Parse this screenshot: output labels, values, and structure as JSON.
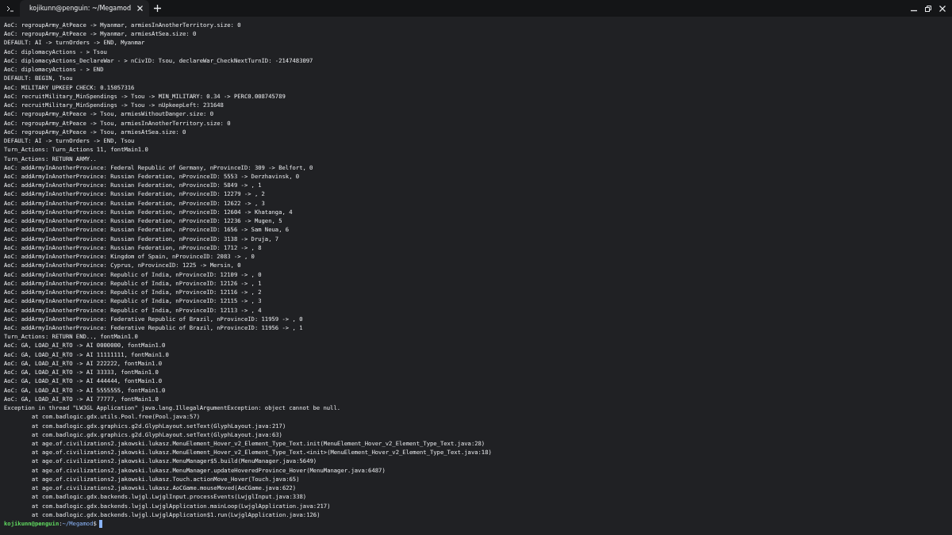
{
  "window": {
    "tabs": [
      {
        "title": "kojikunn@penguin: ~/Megamod",
        "selected": true
      }
    ]
  },
  "output": [
    {
      "kind": "log",
      "text": "AoC: regroupArmy_AtPeace -> Myanmar, armiesInAnotherTerritory.size: 0"
    },
    {
      "kind": "log",
      "text": "AoC: regroupArmy_AtPeace -> Myanmar, armiesAtSea.size: 0"
    },
    {
      "kind": "log",
      "text": "DEFAULT: AI -> turnOrders -> END, Myanmar"
    },
    {
      "kind": "log",
      "text": "AoC: diplomacyActions - > Tsou"
    },
    {
      "kind": "log",
      "text": "AoC: diplomacyActions_DeclareWar - > nCivID: Tsou, declareWar_CheckNextTurnID: -2147483097"
    },
    {
      "kind": "log",
      "text": "AoC: diplomacyActions - > END"
    },
    {
      "kind": "log",
      "text": "DEFAULT: BEGIN, Tsou"
    },
    {
      "kind": "log",
      "text": "AoC: MILITARY UPKEEP CHECK: 0.15057316"
    },
    {
      "kind": "log",
      "text": "AoC: recruitMilitary_MinSpendings -> Tsou -> MIN_MILITARY: 0.34 -> PERC0.008745789"
    },
    {
      "kind": "log",
      "text": "AoC: recruitMilitary_MinSpendings -> Tsou -> nUpkeepLeft: 231648"
    },
    {
      "kind": "log",
      "text": "AoC: regroupArmy_AtPeace -> Tsou, armiesWithoutDanger.size: 0"
    },
    {
      "kind": "log",
      "text": "AoC: regroupArmy_AtPeace -> Tsou, armiesInAnotherTerritory.size: 0"
    },
    {
      "kind": "log",
      "text": "AoC: regroupArmy_AtPeace -> Tsou, armiesAtSea.size: 0"
    },
    {
      "kind": "log",
      "text": "DEFAULT: AI -> turnOrders -> END, Tsou"
    },
    {
      "kind": "log",
      "text": "Turn_Actions: Turn_Actions 11, fontMain1.0"
    },
    {
      "kind": "log",
      "text": "Turn_Actions: RETURN ARMY.."
    },
    {
      "kind": "log",
      "text": "AoC: addArmyInAnotherProvince: Federal Republic of Germany, nProvinceID: 309 -> Belfort, 0"
    },
    {
      "kind": "log",
      "text": "AoC: addArmyInAnotherProvince: Russian Federation, nProvinceID: 5553 -> Derzhavinsk, 0"
    },
    {
      "kind": "log",
      "text": "AoC: addArmyInAnotherProvince: Russian Federation, nProvinceID: 5849 -> , 1"
    },
    {
      "kind": "log",
      "text": "AoC: addArmyInAnotherProvince: Russian Federation, nProvinceID: 12279 -> , 2"
    },
    {
      "kind": "log",
      "text": "AoC: addArmyInAnotherProvince: Russian Federation, nProvinceID: 12622 -> , 3"
    },
    {
      "kind": "log",
      "text": "AoC: addArmyInAnotherProvince: Russian Federation, nProvinceID: 12604 -> Khatanga, 4"
    },
    {
      "kind": "log",
      "text": "AoC: addArmyInAnotherProvince: Russian Federation, nProvinceID: 12236 -> Mugen, 5"
    },
    {
      "kind": "log",
      "text": "AoC: addArmyInAnotherProvince: Russian Federation, nProvinceID: 1656 -> Sam Neua, 6"
    },
    {
      "kind": "log",
      "text": "AoC: addArmyInAnotherProvince: Russian Federation, nProvinceID: 3138 -> Druja, 7"
    },
    {
      "kind": "log",
      "text": "AoC: addArmyInAnotherProvince: Russian Federation, nProvinceID: 1712 -> , 8"
    },
    {
      "kind": "log",
      "text": "AoC: addArmyInAnotherProvince: Kingdom of Spain, nProvinceID: 2083 -> , 0"
    },
    {
      "kind": "log",
      "text": "AoC: addArmyInAnotherProvince: Cyprus, nProvinceID: 1225 -> Mersin, 0"
    },
    {
      "kind": "log",
      "text": "AoC: addArmyInAnotherProvince: Republic of India, nProvinceID: 12109 -> , 0"
    },
    {
      "kind": "log",
      "text": "AoC: addArmyInAnotherProvince: Republic of India, nProvinceID: 12126 -> , 1"
    },
    {
      "kind": "log",
      "text": "AoC: addArmyInAnotherProvince: Republic of India, nProvinceID: 12116 -> , 2"
    },
    {
      "kind": "log",
      "text": "AoC: addArmyInAnotherProvince: Republic of India, nProvinceID: 12115 -> , 3"
    },
    {
      "kind": "log",
      "text": "AoC: addArmyInAnotherProvince: Republic of India, nProvinceID: 12113 -> , 4"
    },
    {
      "kind": "log",
      "text": "AoC: addArmyInAnotherProvince: Federative Republic of Brazil, nProvinceID: 11959 -> , 0"
    },
    {
      "kind": "log",
      "text": "AoC: addArmyInAnotherProvince: Federative Republic of Brazil, nProvinceID: 11956 -> , 1"
    },
    {
      "kind": "log",
      "text": "Turn_Actions: RETURN END.., fontMain1.0"
    },
    {
      "kind": "log",
      "text": "AoC: GA, LOAD_AI_RTO -> AI 0000000, fontMain1.0"
    },
    {
      "kind": "log",
      "text": "AoC: GA, LOAD_AI_RTO -> AI 11111111, fontMain1.0"
    },
    {
      "kind": "log",
      "text": "AoC: GA, LOAD_AI_RTO -> AI 222222, fontMain1.0"
    },
    {
      "kind": "log",
      "text": "AoC: GA, LOAD_AI_RTO -> AI 33333, fontMain1.0"
    },
    {
      "kind": "log",
      "text": "AoC: GA, LOAD_AI_RTO -> AI 444444, fontMain1.0"
    },
    {
      "kind": "log",
      "text": "AoC: GA, LOAD_AI_RTO -> AI 5555555, fontMain1.0"
    },
    {
      "kind": "log",
      "text": "AoC: GA, LOAD_AI_RTO -> AI 77777, fontMain1.0"
    },
    {
      "kind": "log",
      "text": "Exception in thread \"LWJGL Application\" java.lang.IllegalArgumentException: object cannot be null."
    },
    {
      "kind": "trace",
      "text": "at com.badlogic.gdx.utils.Pool.free(Pool.java:57)"
    },
    {
      "kind": "trace",
      "text": "at com.badlogic.gdx.graphics.g2d.GlyphLayout.setText(GlyphLayout.java:217)"
    },
    {
      "kind": "trace",
      "text": "at com.badlogic.gdx.graphics.g2d.GlyphLayout.setText(GlyphLayout.java:63)"
    },
    {
      "kind": "trace",
      "text": "at age.of.civilizations2.jakowski.lukasz.MenuElement_Hover_v2_Element_Type_Text.init(MenuElement_Hover_v2_Element_Type_Text.java:28)"
    },
    {
      "kind": "trace",
      "text": "at age.of.civilizations2.jakowski.lukasz.MenuElement_Hover_v2_Element_Type_Text.<init>(MenuElement_Hover_v2_Element_Type_Text.java:18)"
    },
    {
      "kind": "trace",
      "text": "at age.of.civilizations2.jakowski.lukasz.MenuManager$5.build(MenuManager.java:5649)"
    },
    {
      "kind": "trace",
      "text": "at age.of.civilizations2.jakowski.lukasz.MenuManager.updateHoveredProvince_Hover(MenuManager.java:6487)"
    },
    {
      "kind": "trace",
      "text": "at age.of.civilizations2.jakowski.lukasz.Touch.actionMove_Hover(Touch.java:65)"
    },
    {
      "kind": "trace",
      "text": "at age.of.civilizations2.jakowski.lukasz.AoCGame.mouseMoved(AoCGame.java:622)"
    },
    {
      "kind": "trace",
      "text": "at com.badlogic.gdx.backends.lwjgl.LwjglInput.processEvents(LwjglInput.java:338)"
    },
    {
      "kind": "trace",
      "text": "at com.badlogic.gdx.backends.lwjgl.LwjglApplication.mainLoop(LwjglApplication.java:217)"
    },
    {
      "kind": "trace",
      "text": "at com.badlogic.gdx.backends.lwjgl.LwjglApplication$1.run(LwjglApplication.java:126)"
    }
  ],
  "prompt": {
    "user_host": "kojikunn@penguin",
    "separator": ":",
    "path": "~/Megamod",
    "symbol": "$"
  }
}
